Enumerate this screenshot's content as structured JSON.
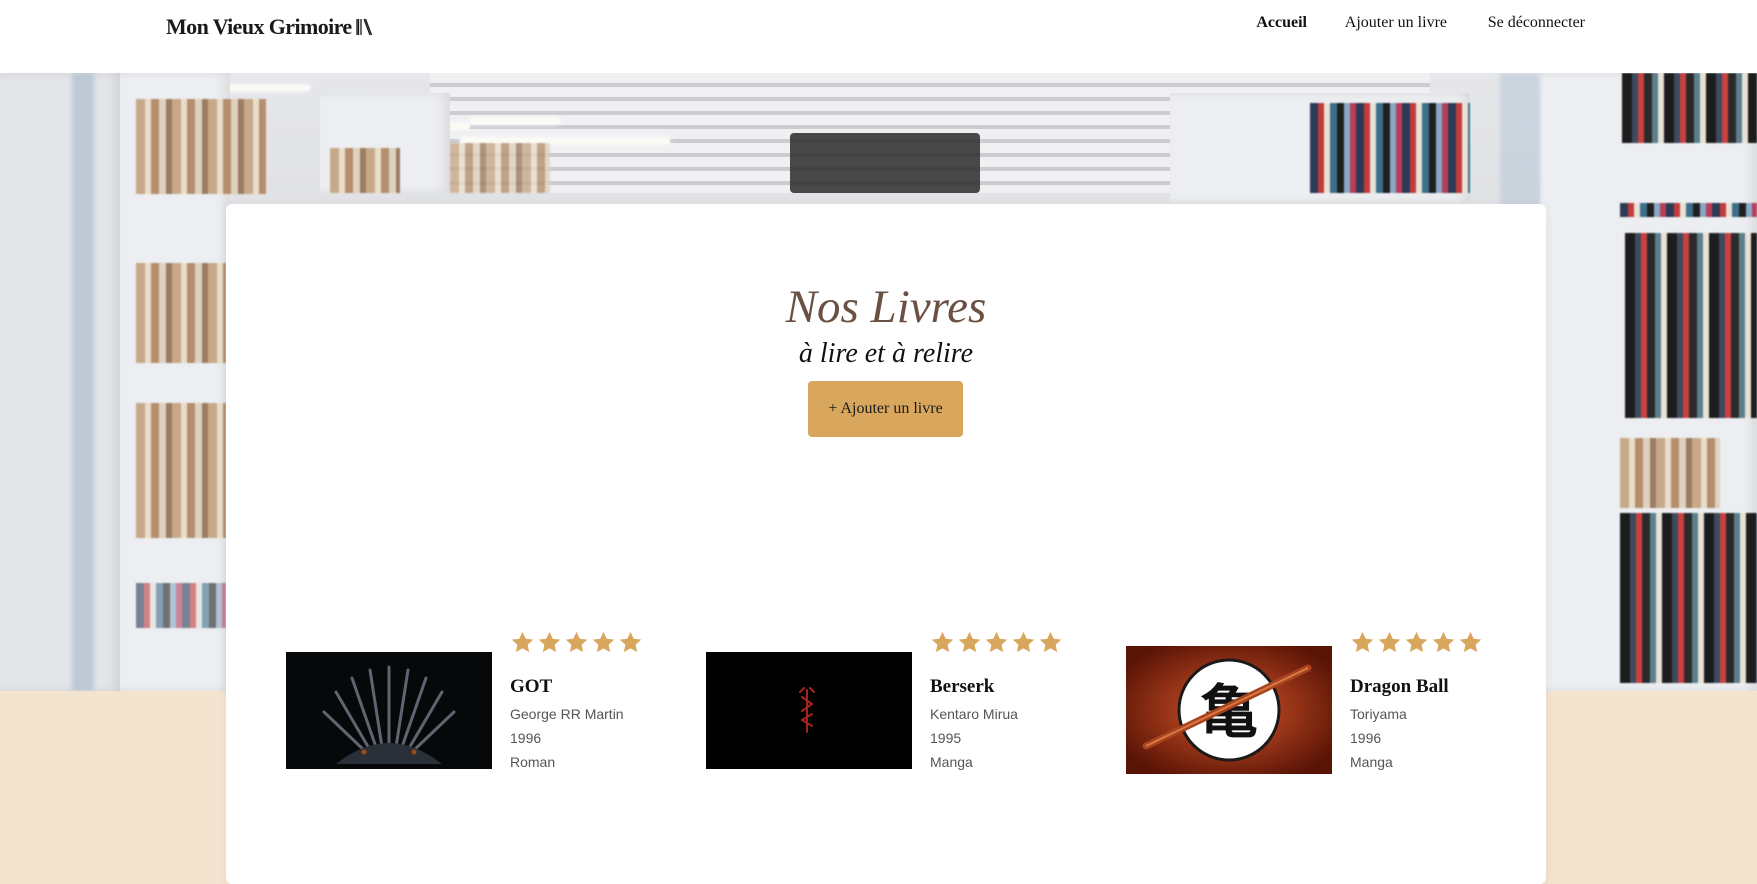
{
  "header": {
    "logo": "Mon Vieux Grimoire",
    "nav": [
      {
        "label": "Accueil",
        "active": true
      },
      {
        "label": "Ajouter un livre",
        "active": false
      },
      {
        "label": "Se déconnecter",
        "active": false
      }
    ]
  },
  "main": {
    "title": "Nos Livres",
    "subtitle": "à lire et à relire",
    "add_button": "+ Ajouter un livre"
  },
  "books": [
    {
      "title": "GOT",
      "author": "George RR Martin",
      "year": "1996",
      "genre": "Roman",
      "rating": 5,
      "cover_icon": "iron-throne-cover"
    },
    {
      "title": "Berserk",
      "author": "Kentaro Mirua",
      "year": "1995",
      "genre": "Manga",
      "rating": 5,
      "cover_icon": "brand-of-sacrifice-cover"
    },
    {
      "title": "Dragon Ball",
      "author": "Toriyama",
      "year": "1996",
      "genre": "Manga",
      "rating": 5,
      "cover_icon": "kame-symbol-cover"
    }
  ],
  "colors": {
    "accent": "#d8a65d",
    "title": "#6a5143",
    "background": "#f2e4cf",
    "star": "#d8a65d"
  }
}
